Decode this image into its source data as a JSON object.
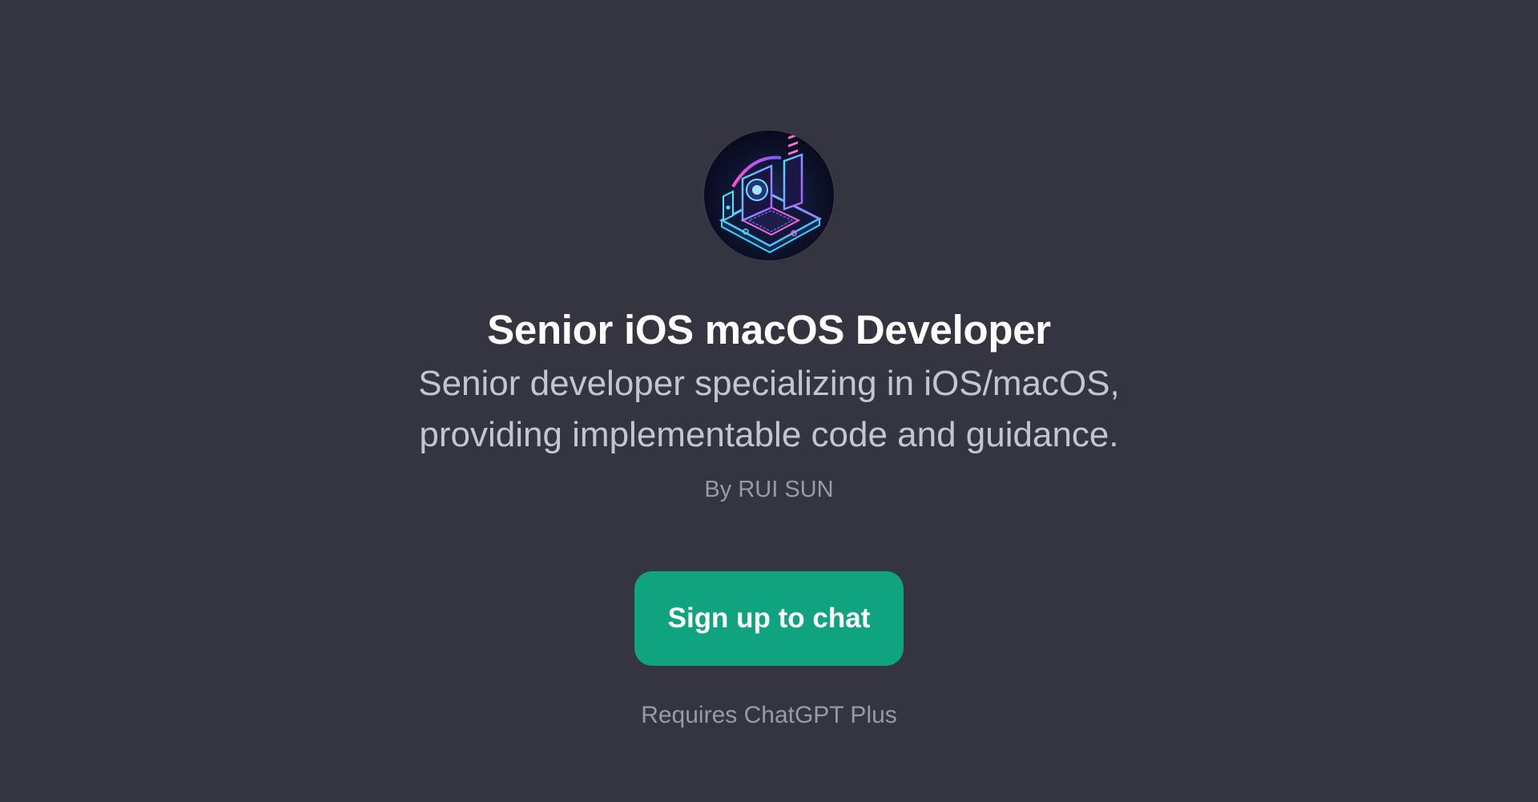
{
  "gpt": {
    "title": "Senior iOS macOS Developer",
    "description_lines": [
      "Senior developer specializing in iOS/macOS,",
      "providing implementable code and guidance."
    ],
    "author": "By RUI SUN",
    "avatar_icon": "isometric-computer-app-icon"
  },
  "cta": {
    "signup_label": "Sign up to chat",
    "requirement": "Requires ChatGPT Plus"
  },
  "colors": {
    "background": "#343541",
    "accent": "#10a37f",
    "title_text": "#ffffff",
    "body_text": "#c5c5d2",
    "muted_text": "#9a9aa6"
  }
}
